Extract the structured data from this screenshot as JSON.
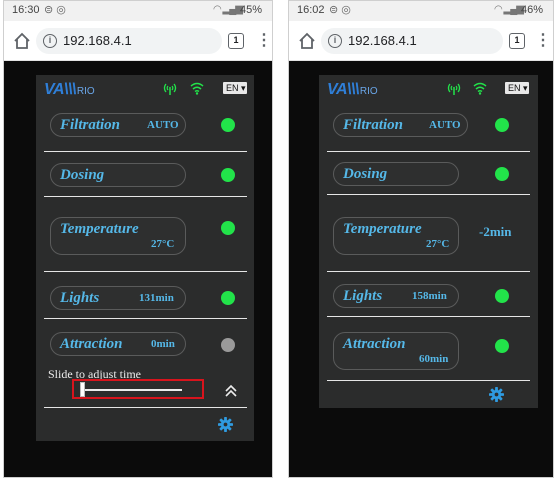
{
  "left": {
    "status": {
      "time": "16:30",
      "icons": "⊜ ◎",
      "battery": "45%"
    },
    "browser": {
      "url": "192.168.4.1",
      "tabs_count": "1",
      "menu": "⋮"
    },
    "app": {
      "logo": "VA\\\\\\RIO",
      "language": "EN ▾",
      "rows": [
        {
          "title": "Filtration",
          "value": "AUTO",
          "indicator": "#22e34a"
        },
        {
          "title": "Dosing",
          "value": "",
          "indicator": "#22e34a"
        },
        {
          "title": "Temperature",
          "value": "27°C",
          "indicator": "#22e34a"
        },
        {
          "title": "Lights",
          "value": "131min",
          "indicator": "#22e34a"
        },
        {
          "title": "Attraction",
          "value": "0min",
          "indicator": "#9a9a9a"
        }
      ],
      "slider": {
        "label": "Slide to adjust time",
        "position": 0.0
      }
    }
  },
  "right": {
    "status": {
      "time": "16:02",
      "icons": "⊜ ◎",
      "battery": "46%"
    },
    "browser": {
      "url": "192.168.4.1",
      "tabs_count": "1",
      "menu": "⋮"
    },
    "app": {
      "logo": "VA\\\\\\RIO",
      "language": "EN ▾",
      "rows": [
        {
          "title": "Filtration",
          "value": "AUTO",
          "indicator": "#22e34a"
        },
        {
          "title": "Dosing",
          "value": "",
          "indicator": "#22e34a"
        },
        {
          "title": "Temperature",
          "value": "27°C",
          "side_value": "-2min"
        },
        {
          "title": "Lights",
          "value": "158min",
          "indicator": "#22e34a"
        },
        {
          "title": "Attraction",
          "value": "60min",
          "indicator": "#22e34a"
        }
      ]
    }
  },
  "colors": {
    "accent": "#55b8e8",
    "panel": "#2b2c2c",
    "on": "#22e34a",
    "off": "#9a9a9a",
    "highlight": "#d8141d"
  }
}
